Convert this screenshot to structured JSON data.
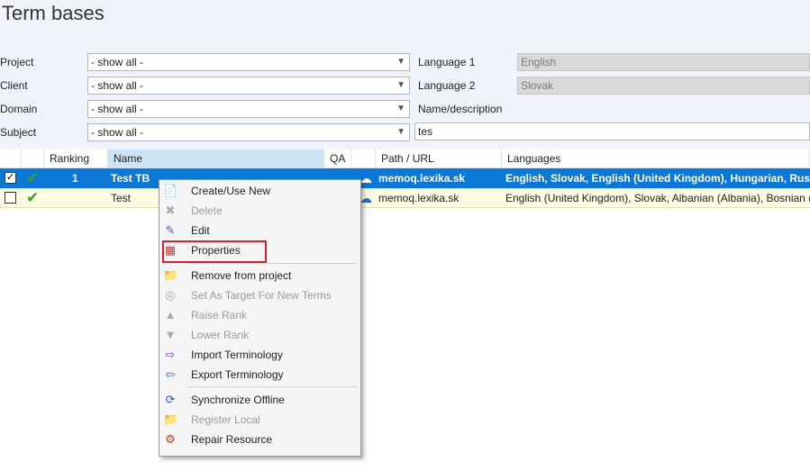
{
  "page": {
    "title": "Term bases"
  },
  "filters": {
    "project": {
      "label": "Project",
      "value": "- show all -"
    },
    "client": {
      "label": "Client",
      "value": "- show all -"
    },
    "domain": {
      "label": "Domain",
      "value": "- show all -"
    },
    "subject": {
      "label": "Subject",
      "value": "- show all -"
    },
    "language1": {
      "label": "Language 1",
      "value": "English"
    },
    "language2": {
      "label": "Language 2",
      "value": "Slovak"
    },
    "name_description": {
      "label": "Name/description",
      "value": ""
    },
    "search": {
      "value": "tes"
    }
  },
  "table": {
    "columns": [
      "Ranking",
      "Name",
      "QA",
      "Path / URL",
      "Languages"
    ],
    "rows": [
      {
        "checked": true,
        "ranking": "1",
        "name": "Test TB",
        "path": "memoq.lexika.sk",
        "languages": "English, Slovak, English (United Kingdom), Hungarian, Russian"
      },
      {
        "checked": false,
        "ranking": "",
        "name": "Test",
        "path": "memoq.lexika.sk",
        "languages": "English (United Kingdom), Slovak, Albanian (Albania), Bosnian (Cyr"
      }
    ]
  },
  "context_menu": {
    "items": [
      {
        "label": "Create/Use New",
        "icon": "new-document-icon",
        "enabled": true
      },
      {
        "label": "Delete",
        "icon": "delete-icon",
        "enabled": false
      },
      {
        "label": "Edit",
        "icon": "edit-icon",
        "enabled": true
      },
      {
        "label": "Properties",
        "icon": "properties-icon",
        "enabled": true,
        "highlighted": true
      },
      {
        "label": "Remove from project",
        "icon": "remove-folder-icon",
        "enabled": true
      },
      {
        "label": "Set As Target For New Terms",
        "icon": "target-icon",
        "enabled": false
      },
      {
        "label": "Raise Rank",
        "icon": "raise-rank-icon",
        "enabled": false
      },
      {
        "label": "Lower Rank",
        "icon": "lower-rank-icon",
        "enabled": false
      },
      {
        "label": "Import Terminology",
        "icon": "import-icon",
        "enabled": true
      },
      {
        "label": "Export Terminology",
        "icon": "export-icon",
        "enabled": true
      },
      {
        "label": "Synchronize Offline",
        "icon": "sync-icon",
        "enabled": true
      },
      {
        "label": "Register Local",
        "icon": "register-local-icon",
        "enabled": false
      },
      {
        "label": "Repair Resource",
        "icon": "repair-icon",
        "enabled": true
      }
    ]
  },
  "colors": {
    "selected_row": "#0a78d4",
    "alt_row": "#fdfbe2",
    "highlight_border": "#d3202a",
    "check_green": "#3aa319"
  }
}
